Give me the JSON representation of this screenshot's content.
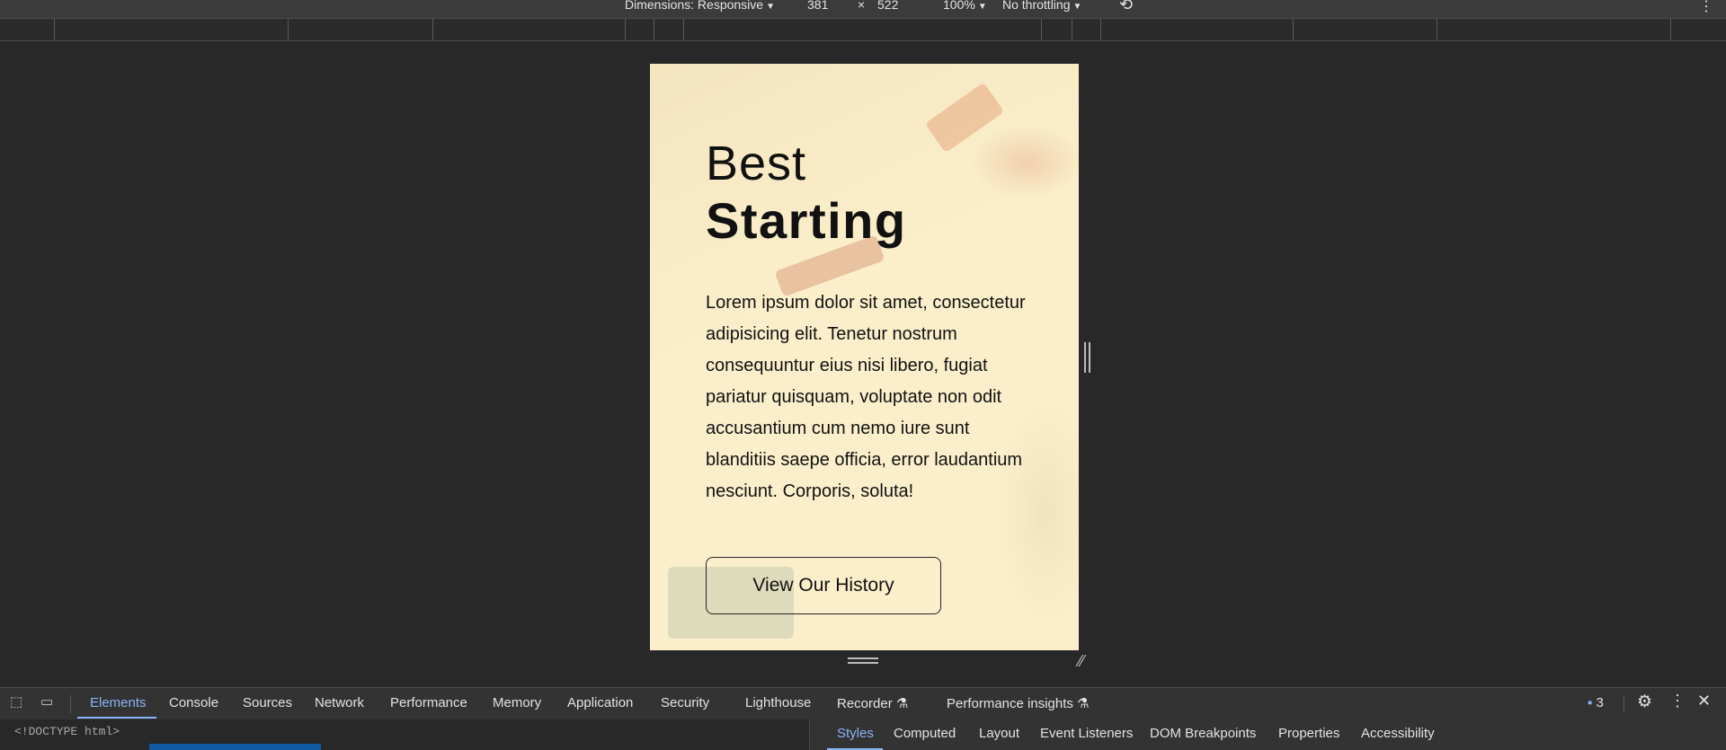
{
  "device_toolbar": {
    "dimensions_label": "Dimensions: Responsive",
    "width": "381",
    "times": "×",
    "height": "522",
    "zoom": "100%",
    "throttling": "No throttling"
  },
  "hero": {
    "title_light": "Best",
    "title_bold": "Starting",
    "paragraph": "Lorem ipsum dolor sit amet, consectetur adipisicing elit. Tenetur nostrum consequuntur eius nisi libero, fugiat pariatur quisquam, voluptate non odit accusantium cum nemo iure sunt blanditiis saepe officia, error laudantium nesciunt. Corporis, soluta!",
    "cta_label": "View Our History"
  },
  "devtools": {
    "tabs": [
      "Elements",
      "Console",
      "Sources",
      "Network",
      "Performance",
      "Memory",
      "Application",
      "Security",
      "Lighthouse",
      "Recorder",
      "Performance insights"
    ],
    "issues_count": "3",
    "doctype": "<!DOCTYPE html>",
    "side_tabs": [
      "Styles",
      "Computed",
      "Layout",
      "Event Listeners",
      "DOM Breakpoints",
      "Properties",
      "Accessibility"
    ]
  },
  "colors": {
    "viewport_bg": "#fbefcb",
    "accent": "#8ab4f8",
    "devtools_bg": "#282828"
  }
}
